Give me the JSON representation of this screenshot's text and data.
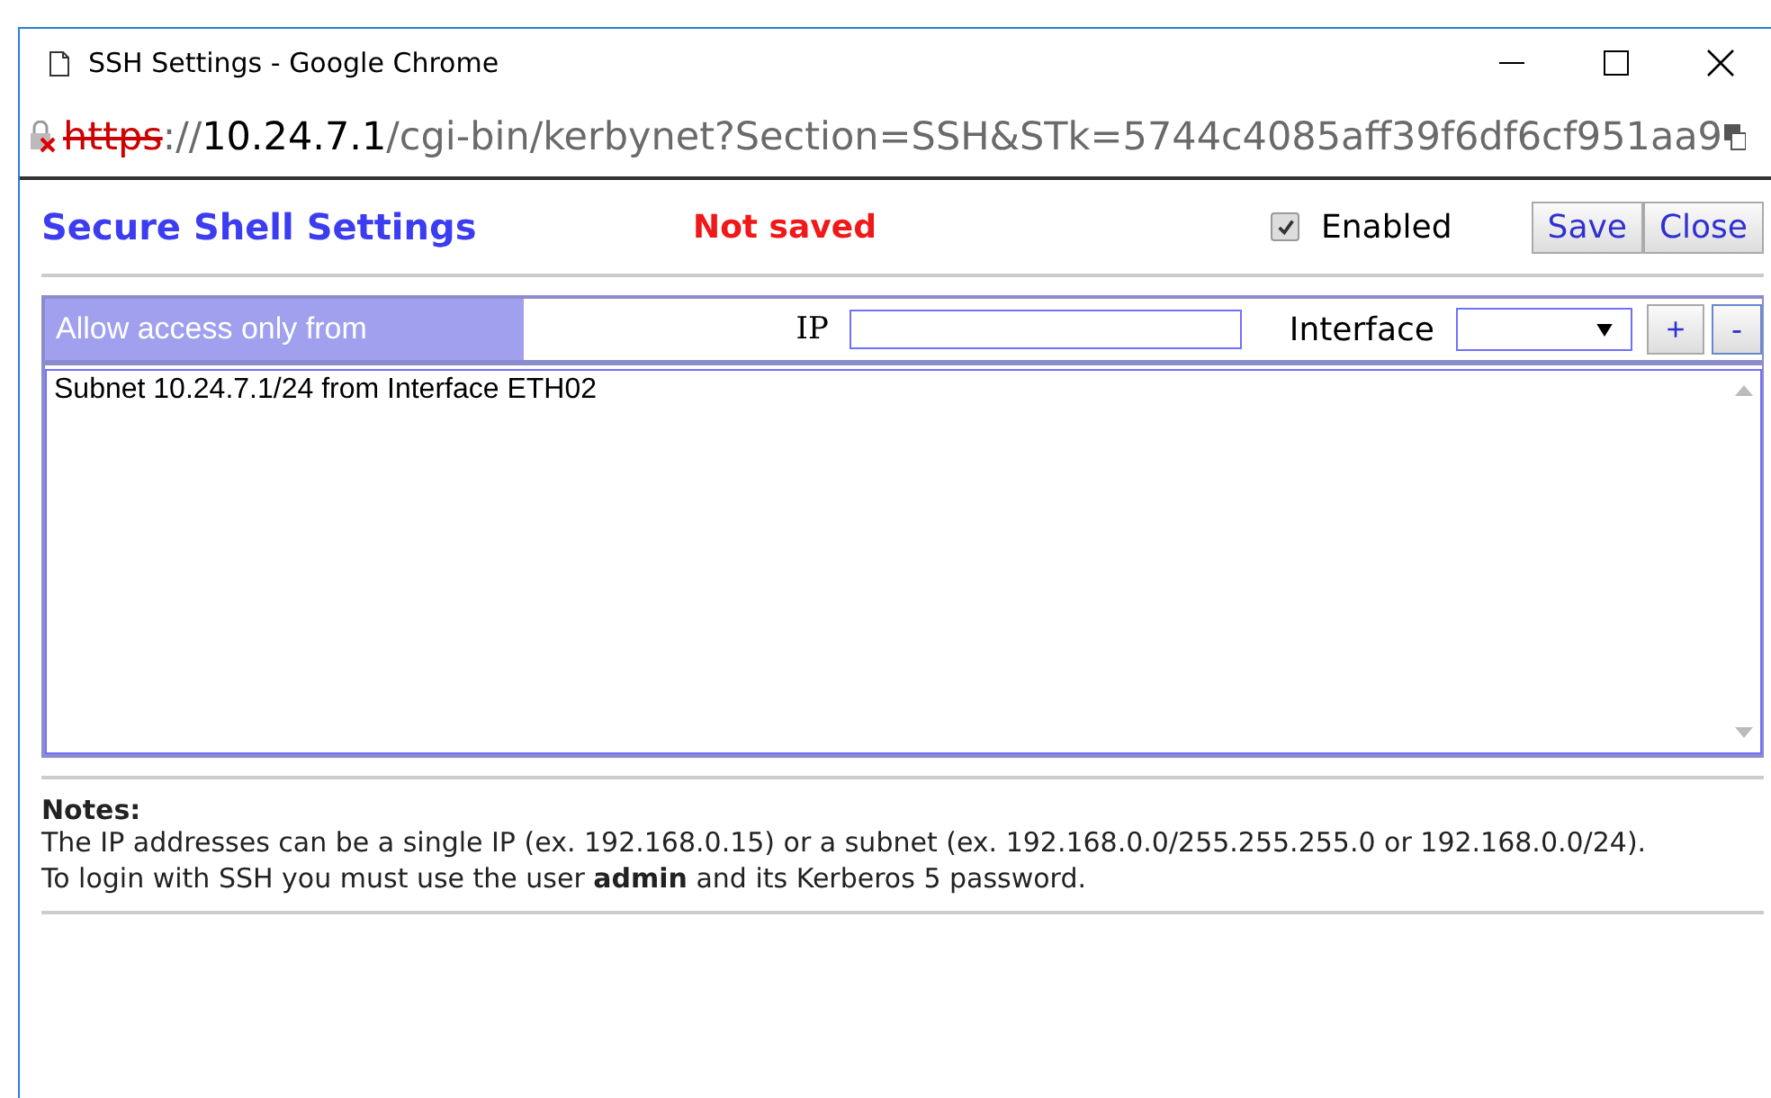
{
  "window": {
    "title": "SSH Settings - Google Chrome"
  },
  "address_bar": {
    "secure": false,
    "scheme": "https",
    "separator": "://",
    "host": "10.24.7.1",
    "path": "/cgi-bin/kerbynet?Section=SSH&STk=5744c4085aff39f6df6cf951aa9"
  },
  "header": {
    "title": "Secure Shell Settings",
    "status": "Not saved",
    "enabled": {
      "label": "Enabled",
      "checked": true
    },
    "buttons": [
      "Save",
      "Close"
    ]
  },
  "access": {
    "title": "Allow access only from",
    "ip_label": "IP",
    "interface_label": "Interface",
    "add": "+",
    "remove": "-",
    "entries": [
      "Subnet 10.24.7.1/24 from Interface ETH02"
    ]
  },
  "notes": {
    "title": "Notes:",
    "lines": [
      "The IP addresses can be a single IP (ex. 192.168.0.15) or a subnet (ex. 192.168.0.0/255.255.255.0 or 192.168.0.0/24).",
      "To login with SSH you must use the user **admin** and its Kerberos 5 password."
    ]
  }
}
